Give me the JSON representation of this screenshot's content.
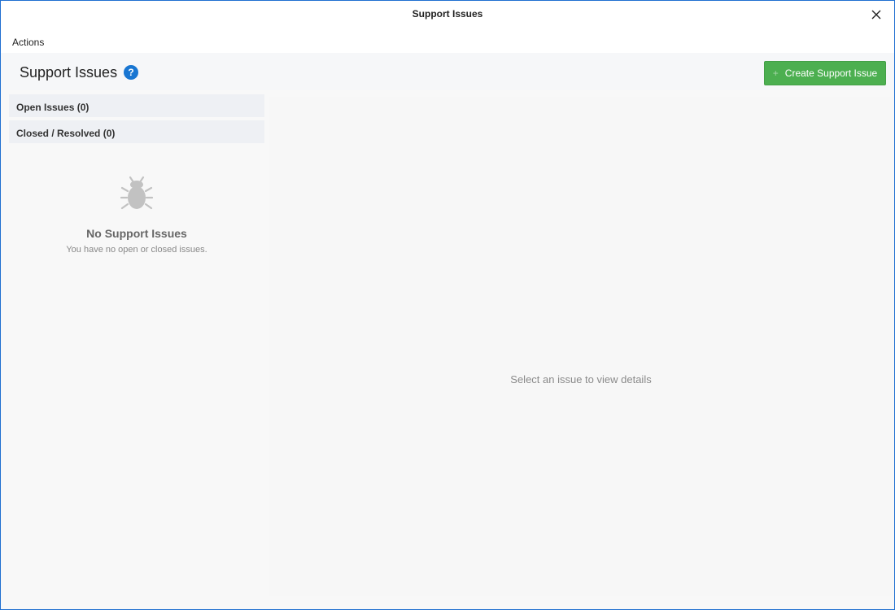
{
  "window": {
    "title": "Support Issues"
  },
  "menu": {
    "actions": "Actions"
  },
  "header": {
    "title": "Support Issues",
    "help": "?",
    "create_button": "Create Support Issue",
    "create_icon": "+"
  },
  "sidebar": {
    "open_issues": "Open Issues (0)",
    "closed_issues": "Closed / Resolved (0)",
    "empty_title": "No Support Issues",
    "empty_subtitle": "You have no open or closed issues.",
    "empty_icon": "bug-icon"
  },
  "detail": {
    "placeholder": "Select an issue to view details"
  },
  "colors": {
    "accent": "#4caf50",
    "help": "#1976d2",
    "border": "#1f6fd1"
  }
}
